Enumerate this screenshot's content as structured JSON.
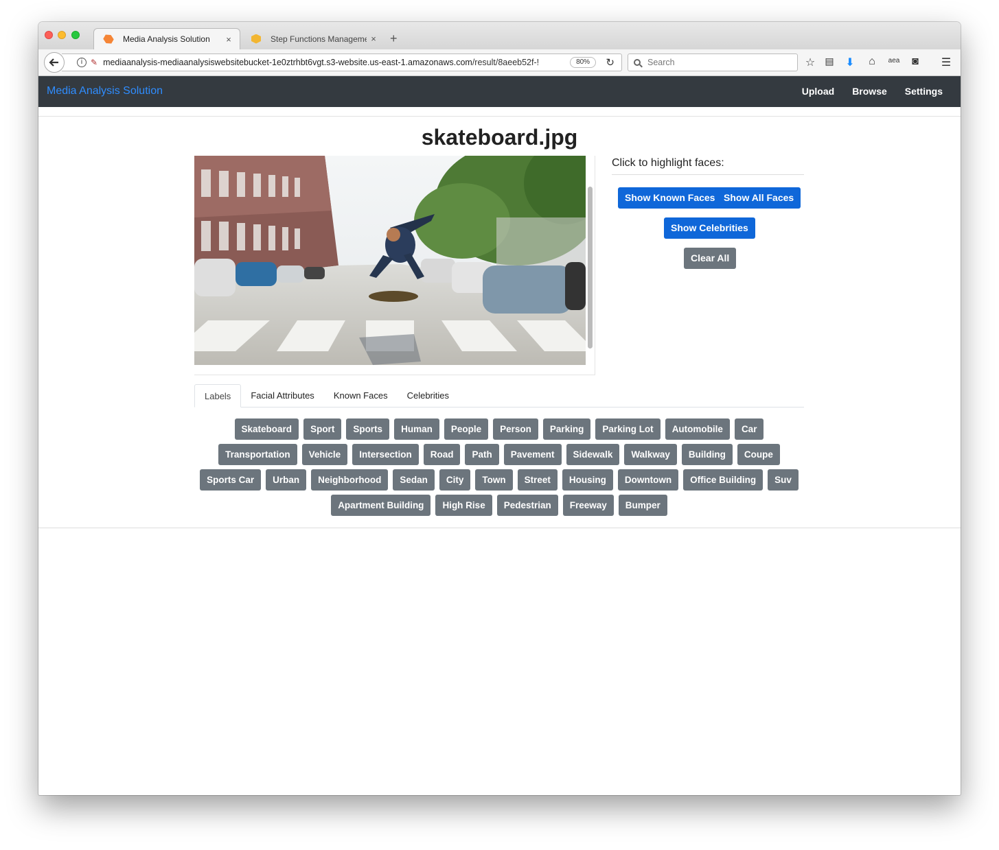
{
  "browser": {
    "tabs": [
      {
        "title": "Media Analysis Solution",
        "icon": "aws-orange-cube-icon",
        "close": "×"
      },
      {
        "title": "Step Functions Manageme...",
        "icon": "aws-yellow-cube-icon",
        "close": "×"
      }
    ],
    "new_tab": "+",
    "url_host": "mediaanalysis-mediaanalysiswebsitebucket-1e0ztrhbt6vgt.s3-website.us-east-1.amazonaws.com",
    "url_path": "/result/8aeeb52f-!",
    "zoom": "80%",
    "search_placeholder": "Search",
    "amazon_label": "aea"
  },
  "site": {
    "brand": "Media Analysis Solution",
    "nav": {
      "upload": "Upload",
      "browse": "Browse",
      "settings": "Settings"
    },
    "brand_color": "#2f8dff",
    "navbar_color": "#343a40"
  },
  "result": {
    "filename": "skateboard.jpg",
    "faces_heading": "Click to highlight faces:",
    "buttons": {
      "show_known_faces": "Show Known Faces",
      "show_all_faces": "Show All Faces",
      "show_celebrities": "Show Celebrities",
      "clear_all": "Clear All"
    },
    "tabs": [
      "Labels",
      "Facial Attributes",
      "Known Faces",
      "Celebrities"
    ],
    "active_tab": "Labels",
    "labels": [
      "Skateboard",
      "Sport",
      "Sports",
      "Human",
      "People",
      "Person",
      "Parking",
      "Parking Lot",
      "Automobile",
      "Car",
      "Transportation",
      "Vehicle",
      "Intersection",
      "Road",
      "Path",
      "Pavement",
      "Sidewalk",
      "Walkway",
      "Building",
      "Coupe",
      "Sports Car",
      "Urban",
      "Neighborhood",
      "Sedan",
      "City",
      "Town",
      "Street",
      "Housing",
      "Downtown",
      "Office Building",
      "Suv",
      "Apartment Building",
      "High Rise",
      "Pedestrian",
      "Freeway",
      "Bumper"
    ],
    "primary_color": "#0f67d9",
    "secondary_color": "#6c757d"
  }
}
